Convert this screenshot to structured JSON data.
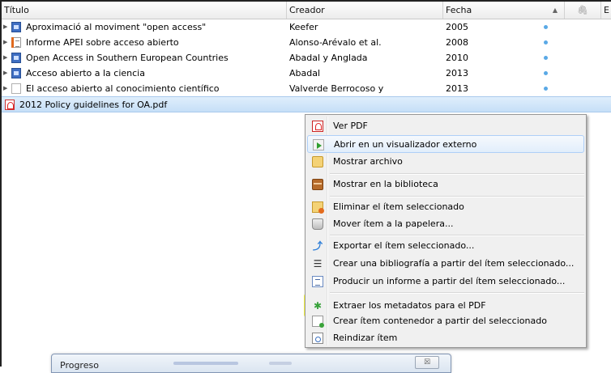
{
  "columns": {
    "title": "Título",
    "creator": "Creador",
    "date": "Fecha",
    "extra": "E"
  },
  "rows": [
    {
      "title": "Aproximació al moviment \"open access\"",
      "creator": "Keefer",
      "date": "2005",
      "icon": "book-section-icon"
    },
    {
      "title": "Informe APEI sobre acceso abierto",
      "creator": "Alonso-Arévalo et al.",
      "date": "2008",
      "icon": "report-icon"
    },
    {
      "title": "Open Access in Southern European Countries",
      "creator": "Abadal y Anglada",
      "date": "2010",
      "icon": "book-icon"
    },
    {
      "title": "Acceso abierto a la ciencia",
      "creator": "Abadal",
      "date": "2013",
      "icon": "book-icon"
    },
    {
      "title": "El acceso abierto al conocimiento científico",
      "creator": "Valverde Berrocoso y",
      "date": "2013",
      "icon": "document-icon"
    },
    {
      "title": "2012 Policy guidelines for OA.pdf",
      "creator": "",
      "date": "",
      "icon": "pdf-icon"
    }
  ],
  "context_menu": [
    {
      "label": "Ver PDF",
      "icon": "pdf-icon"
    },
    {
      "label": "Abrir en un visualizador externo",
      "icon": "open-external-icon"
    },
    {
      "label": "Mostrar archivo",
      "icon": "folder-icon"
    },
    {
      "label": "Mostrar en la biblioteca",
      "icon": "library-icon"
    },
    {
      "label": "Eliminar el ítem seleccionado",
      "icon": "delete-icon"
    },
    {
      "label": "Mover ítem a la papelera...",
      "icon": "trash-icon"
    },
    {
      "label": "Exportar el ítem seleccionado...",
      "icon": "export-icon"
    },
    {
      "label": "Crear una bibliografía a partir del ítem seleccionado...",
      "icon": "bibliography-icon"
    },
    {
      "label": "Producir un informe a partir del ítem seleccionado...",
      "icon": "report-icon"
    },
    {
      "label": "Extraer los metadatos para el PDF",
      "icon": "puzzle-icon"
    },
    {
      "label": "Crear ítem contenedor a partir del seleccionado",
      "icon": "create-parent-icon"
    },
    {
      "label": "Reindizar ítem",
      "icon": "reindex-icon"
    }
  ],
  "progress_dialog": {
    "title": "Progreso",
    "close": "☒"
  },
  "colors": {
    "highlight": "#f5f534",
    "selection": "#c6dff7",
    "attachment_dot": "#5aa9e6"
  }
}
